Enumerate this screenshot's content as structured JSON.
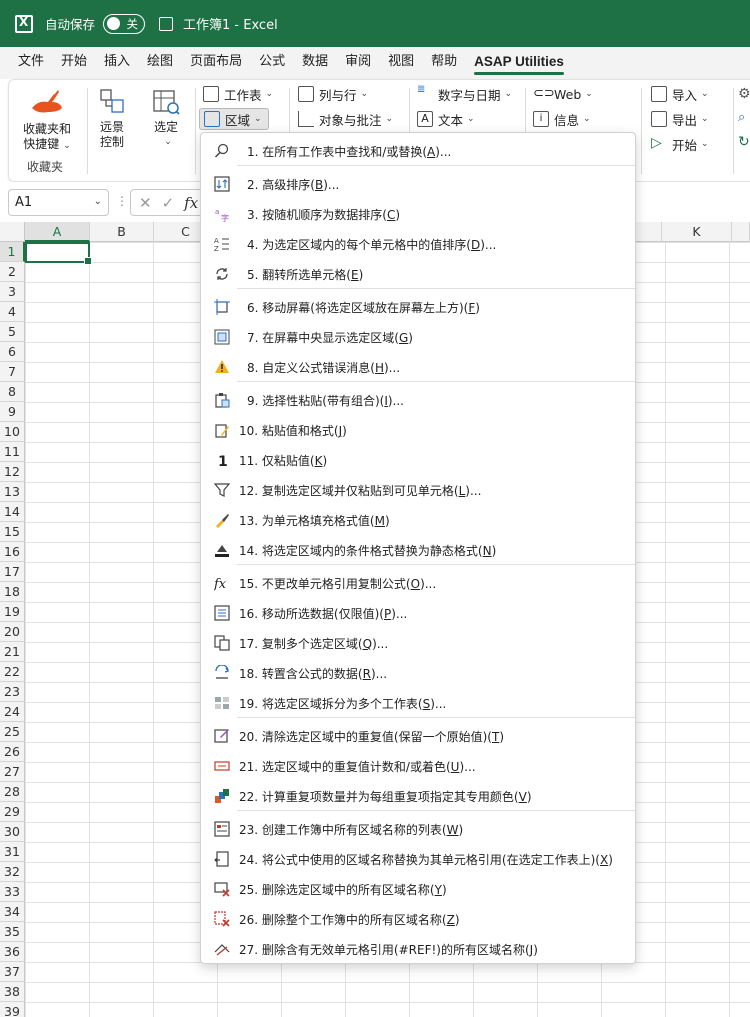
{
  "titlebar": {
    "autosave_label": "自动保存",
    "toggle_label": "关",
    "window_title": "工作簿1  -  Excel"
  },
  "menubar": {
    "tabs": [
      {
        "label": "文件",
        "active": false
      },
      {
        "label": "开始",
        "active": false
      },
      {
        "label": "插入",
        "active": false
      },
      {
        "label": "绘图",
        "active": false
      },
      {
        "label": "页面布局",
        "active": false
      },
      {
        "label": "公式",
        "active": false
      },
      {
        "label": "数据",
        "active": false
      },
      {
        "label": "审阅",
        "active": false
      },
      {
        "label": "视图",
        "active": false
      },
      {
        "label": "帮助",
        "active": false
      },
      {
        "label": "ASAP Utilities",
        "active": true
      }
    ]
  },
  "ribbon": {
    "favorites": {
      "label_line1": "收藏夹和",
      "label_line2": "快捷键",
      "group_label": "收藏夹"
    },
    "remote": {
      "label_line1": "远景",
      "label_line2": "控制"
    },
    "select": {
      "label": "选定"
    },
    "col1": {
      "worksheet": "工作表",
      "range": "区域"
    },
    "col2": {
      "columns_rows": "列与行",
      "objects_comments": "对象与批注"
    },
    "col3": {
      "numbers_dates": "数字与日期",
      "text": "文本"
    },
    "col4": {
      "web": "Web",
      "info": "信息"
    },
    "col5": {
      "import": "导入",
      "export": "导出",
      "start": "开始"
    }
  },
  "formulabar": {
    "namebox": "A1",
    "fx": "fx"
  },
  "grid": {
    "columns": [
      "A",
      "B",
      "C",
      "K"
    ],
    "rows": [
      "1",
      "2",
      "3",
      "4",
      "5",
      "6",
      "7",
      "8",
      "9",
      "10",
      "11",
      "12",
      "13",
      "14",
      "15",
      "16",
      "17",
      "18",
      "19",
      "20",
      "21",
      "22",
      "23",
      "24",
      "25",
      "26",
      "27",
      "28",
      "29",
      "30",
      "31",
      "32",
      "33",
      "34",
      "35",
      "36",
      "37",
      "38",
      "39"
    ]
  },
  "dropdown": {
    "items": [
      {
        "num": "1.",
        "text": "在所有工作表中查找和/或替换(",
        "key": "A",
        "tail": ")..."
      },
      {
        "num": "2.",
        "text": "高级排序(",
        "key": "B",
        "tail": ")..."
      },
      {
        "num": "3.",
        "text": "按随机顺序为数据排序(",
        "key": "C",
        "tail": ")"
      },
      {
        "num": "4.",
        "text": "为选定区域内的每个单元格中的值排序(",
        "key": "D",
        "tail": ")..."
      },
      {
        "num": "5.",
        "text": "翻转所选单元格(",
        "key": "E",
        "tail": ")"
      },
      {
        "num": "6.",
        "text": "移动屏幕(将选定区域放在屏幕左上方)(",
        "key": "F",
        "tail": ")"
      },
      {
        "num": "7.",
        "text": "在屏幕中央显示选定区域(",
        "key": "G",
        "tail": ")"
      },
      {
        "num": "8.",
        "text": "自定义公式错误消息(",
        "key": "H",
        "tail": ")..."
      },
      {
        "num": "9.",
        "text": "选择性粘贴(带有组合)(",
        "key": "I",
        "tail": ")..."
      },
      {
        "num": "10.",
        "text": "粘贴值和格式(",
        "key": "J",
        "tail": ")"
      },
      {
        "num": "11.",
        "text": "仅粘贴值(",
        "key": "K",
        "tail": ")"
      },
      {
        "num": "12.",
        "text": "复制选定区域并仅粘贴到可见单元格(",
        "key": "L",
        "tail": ")..."
      },
      {
        "num": "13.",
        "text": "为单元格填充格式值(",
        "key": "M",
        "tail": ")"
      },
      {
        "num": "14.",
        "text": "将选定区域内的条件格式替换为静态格式(",
        "key": "N",
        "tail": ")"
      },
      {
        "num": "15.",
        "text": "不更改单元格引用复制公式(",
        "key": "O",
        "tail": ")..."
      },
      {
        "num": "16.",
        "text": "移动所选数据(仅限值)(",
        "key": "P",
        "tail": ")..."
      },
      {
        "num": "17.",
        "text": "复制多个选定区域(",
        "key": "Q",
        "tail": ")..."
      },
      {
        "num": "18.",
        "text": "转置含公式的数据(",
        "key": "R",
        "tail": ")..."
      },
      {
        "num": "19.",
        "text": "将选定区域拆分为多个工作表(",
        "key": "S",
        "tail": ")..."
      },
      {
        "num": "20.",
        "text": "清除选定区域中的重复值(保留一个原始值)(",
        "key": "T",
        "tail": ")"
      },
      {
        "num": "21.",
        "text": "选定区域中的重复值计数和/或着色(",
        "key": "U",
        "tail": ")..."
      },
      {
        "num": "22.",
        "text": "计算重复项数量并为每组重复项指定其专用颜色(",
        "key": "V",
        "tail": ")"
      },
      {
        "num": "23.",
        "text": "创建工作簿中所有区域名称的列表(",
        "key": "W",
        "tail": ")"
      },
      {
        "num": "24.",
        "text": "将公式中使用的区域名称替换为其单元格引用(在选定工作表上)(",
        "key": "X",
        "tail": ")"
      },
      {
        "num": "25.",
        "text": "删除选定区域中的所有区域名称(",
        "key": "Y",
        "tail": ")"
      },
      {
        "num": "26.",
        "text": "删除整个工作簿中的所有区域名称(",
        "key": "Z",
        "tail": ")"
      },
      {
        "num": "27.",
        "text": "删除含有无效单元格引用(#REF!)的所有区域名称(",
        "key": "J",
        "tail": ")"
      }
    ]
  }
}
